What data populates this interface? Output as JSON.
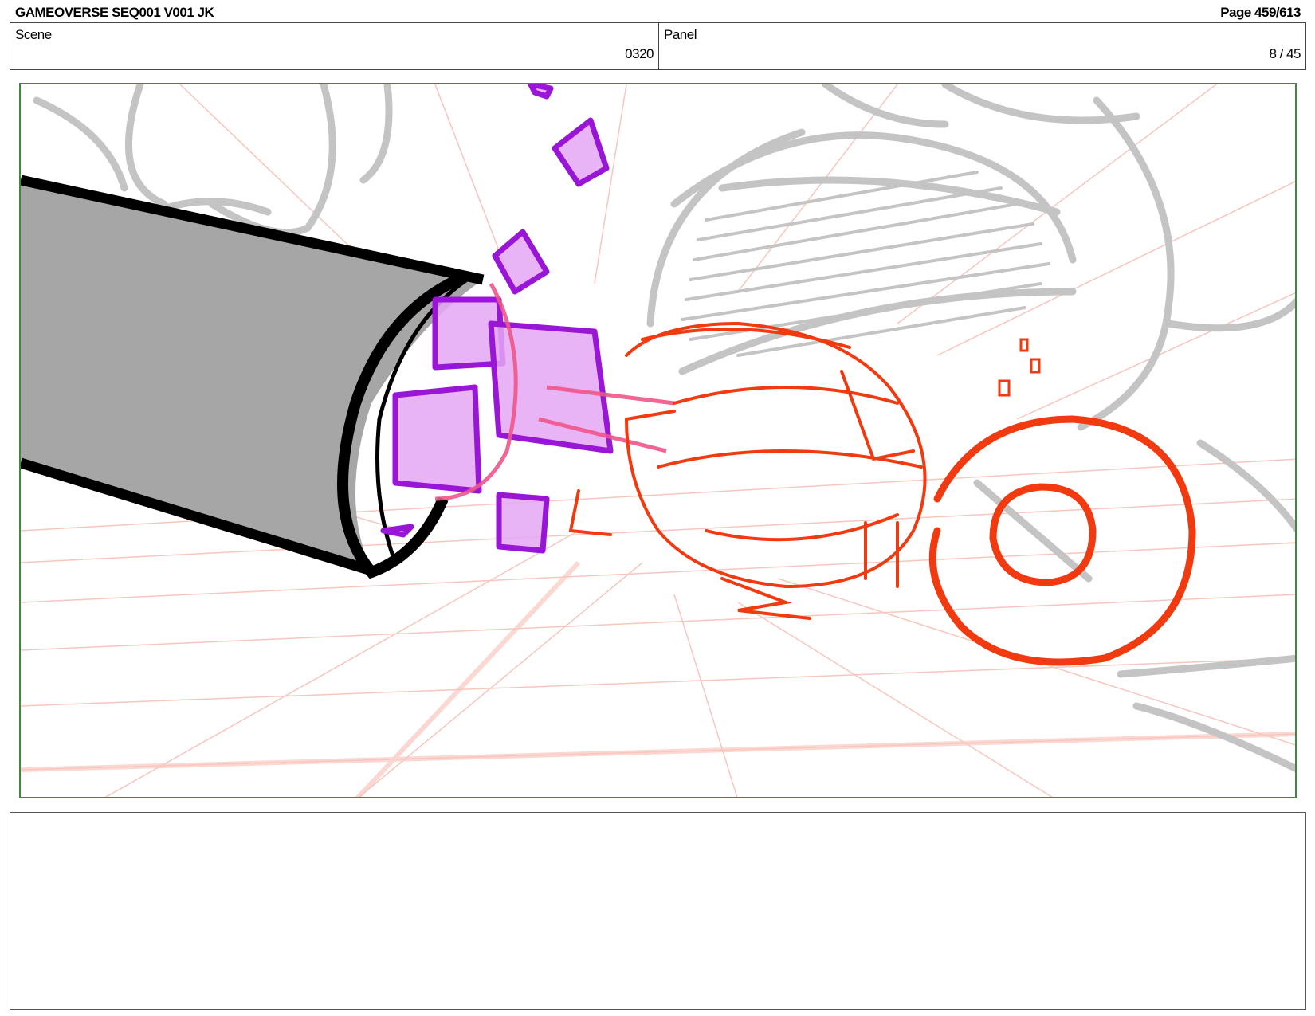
{
  "header": {
    "title": "GAMEOVERSE SEQ001 V001 JK",
    "page": "Page 459/613"
  },
  "info": {
    "scene_label": "Scene",
    "scene_value": "0320",
    "panel_label": "Panel",
    "panel_value": "8 / 45"
  },
  "notes": {
    "text": ""
  },
  "colors": {
    "frame_border": "#3d8a3d",
    "grid": "#f6b8ad",
    "sketch_gray": "#c4c4c4",
    "cube_purple": "#9a16d6",
    "character_red": "#f23a10"
  }
}
